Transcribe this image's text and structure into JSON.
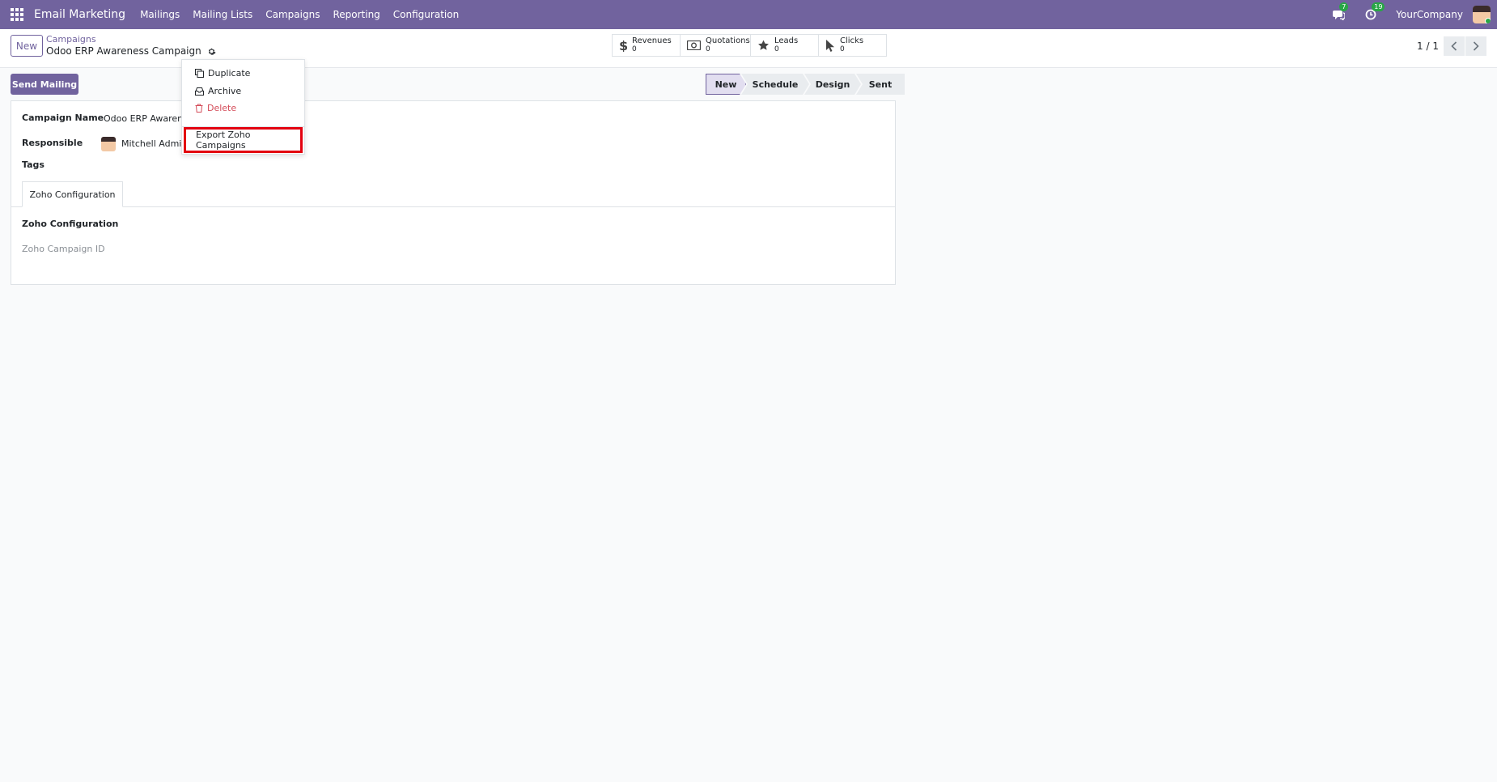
{
  "navbar": {
    "brand": "Email Marketing",
    "menu": [
      "Mailings",
      "Mailing Lists",
      "Campaigns",
      "Reporting",
      "Configuration"
    ],
    "messages_count": "7",
    "activities_count": "19",
    "company": "YourCompany"
  },
  "control": {
    "new_label": "New",
    "breadcrumb_parent": "Campaigns",
    "breadcrumb_current": "Odoo ERP Awareness Campaign",
    "stats": [
      {
        "label": "Revenues",
        "value": "0"
      },
      {
        "label": "Quotations",
        "value": "0"
      },
      {
        "label": "Leads",
        "value": "0"
      },
      {
        "label": "Clicks",
        "value": "0"
      }
    ],
    "pager": "1 / 1"
  },
  "actions": {
    "send_mailing": "Send Mailing"
  },
  "stages": [
    "New",
    "Schedule",
    "Design",
    "Sent"
  ],
  "form": {
    "campaign_name_label": "Campaign Name",
    "campaign_name_value": "Odoo ERP Awarene",
    "responsible_label": "Responsible",
    "responsible_value": "Mitchell Admin",
    "tags_label": "Tags",
    "tab_label": "Zoho Configuration",
    "section_title": "Zoho Configuration",
    "zoho_campaign_id_label": "Zoho Campaign ID"
  },
  "dropdown": {
    "duplicate": "Duplicate",
    "archive": "Archive",
    "delete": "Delete",
    "export": "Export Zoho Campaigns"
  },
  "colors": {
    "brand": "#71639e",
    "highlight": "#e3000f",
    "danger": "#d44c59"
  }
}
